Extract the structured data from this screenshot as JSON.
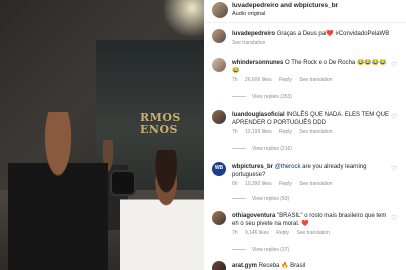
{
  "post": {
    "title": "luvadepedreiro and wbpictures_br",
    "subtitle": "Áudio original"
  },
  "media": {
    "poster_text": "RMOS ENOS"
  },
  "comments": [
    {
      "user": "luvadepedreiro",
      "text": "Graças a Deus pai❤️ #ConvidadoPelaWB",
      "time": "",
      "likes": "",
      "reply": "",
      "see_translation": "See translation",
      "view_replies": ""
    },
    {
      "user": "whindersonnunes",
      "text": "O The Rock e o De Rocha 😂😂😂😂😂",
      "time": "7h",
      "likes": "26,606 likes",
      "reply": "Reply",
      "see_translation": "See translation",
      "view_replies": "View replies (353)"
    },
    {
      "user": "luandouglasoficial",
      "text": "INGLÊS QUE NADA. ELES TEM QUE APRENDER O PORTUGUÊS DDD",
      "time": "7h",
      "likes": "13,199 likes",
      "reply": "Reply",
      "see_translation": "See translation",
      "view_replies": "View replies (216)"
    },
    {
      "user": "wbpictures_br",
      "mention": "@therock",
      "text": "are you already learning portuguese?",
      "time": "6h",
      "likes": "10,390 likes",
      "reply": "Reply",
      "see_translation": "See translation",
      "view_replies": "View replies (93)"
    },
    {
      "user": "othiagoventura",
      "text": "\"BRASIL\" o rosto mais brasileiro que tem eh o seu pivete na moral. ❤️",
      "time": "7h",
      "likes": "9,146 likes",
      "reply": "Reply",
      "see_translation": "See translation",
      "view_replies": "View replies (37)"
    },
    {
      "user": "arat.gym",
      "text": "Receba 🔥 Brasil",
      "time": "",
      "likes": "",
      "reply": "",
      "see_translation": "",
      "view_replies": ""
    }
  ],
  "icons": {
    "like": "heart-icon"
  }
}
